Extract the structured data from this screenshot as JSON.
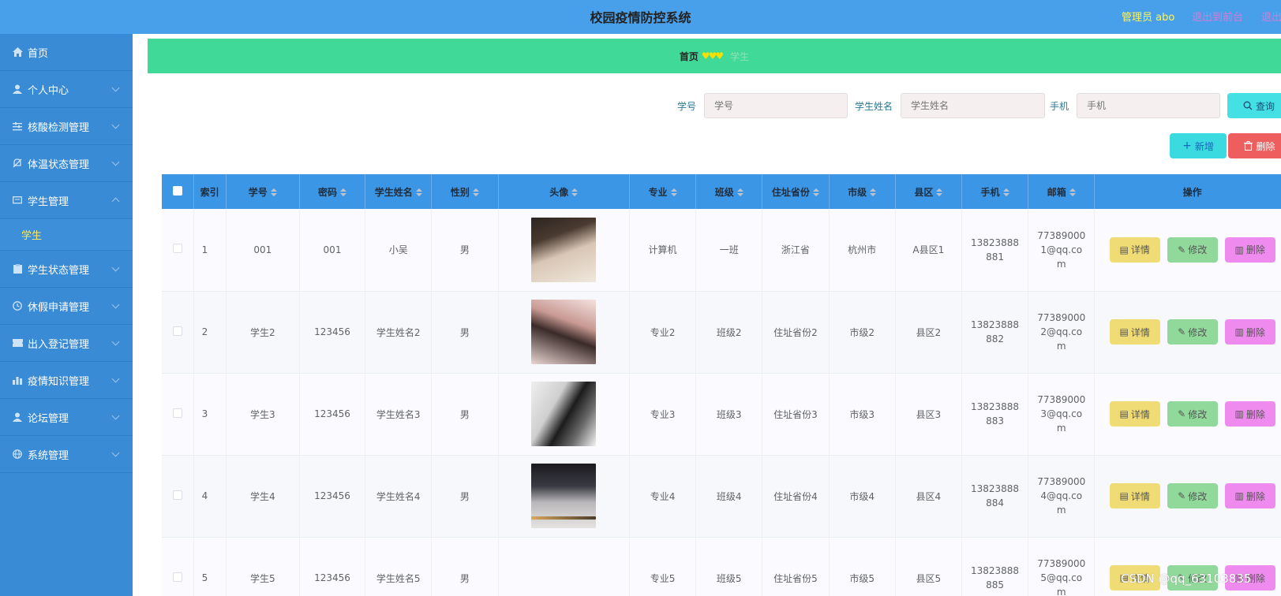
{
  "header": {
    "title": "校园疫情防控系统",
    "admin_label": "管理员 abo",
    "front_link": "退出到前台",
    "logout_link": "退出登录"
  },
  "sidebar": {
    "items": [
      {
        "label": "首页",
        "icon": "home-icon"
      },
      {
        "label": "个人中心",
        "icon": "user-icon"
      },
      {
        "label": "核酸检测管理",
        "icon": "sliders-icon"
      },
      {
        "label": "体温状态管理",
        "icon": "bell-off-icon"
      },
      {
        "label": "学生管理",
        "icon": "message-icon",
        "expanded": true
      },
      {
        "label": "学生状态管理",
        "icon": "clipboard-icon"
      },
      {
        "label": "休假申请管理",
        "icon": "clock-icon"
      },
      {
        "label": "出入登记管理",
        "icon": "ticket-icon"
      },
      {
        "label": "疫情知识管理",
        "icon": "chart-icon"
      },
      {
        "label": "论坛管理",
        "icon": "user-icon"
      },
      {
        "label": "系统管理",
        "icon": "globe-icon"
      }
    ],
    "submenu": {
      "label": "学生"
    }
  },
  "breadcrumb": {
    "home": "首页",
    "hearts": "♥♥♥",
    "current": "学生"
  },
  "search": {
    "student_id_label": "学号",
    "student_id_placeholder": "学号",
    "name_label": "学生姓名",
    "name_placeholder": "学生姓名",
    "phone_label": "手机",
    "phone_placeholder": "手机",
    "query_label": "查询"
  },
  "actions": {
    "add_label": "新增",
    "delete_label": "删除"
  },
  "table": {
    "headers": {
      "index": "索引",
      "student_id": "学号",
      "password": "密码",
      "name": "学生姓名",
      "gender": "性别",
      "avatar": "头像",
      "major": "专业",
      "class": "班级",
      "province": "住址省份",
      "city": "市级",
      "county": "县区",
      "phone": "手机",
      "email": "邮箱",
      "ops": "操作"
    },
    "op_labels": {
      "detail": "详情",
      "edit": "修改",
      "delete": "删除"
    },
    "rows": [
      {
        "index": "1",
        "student_id": "001",
        "password": "001",
        "name": "小吴",
        "gender": "男",
        "major": "计算机",
        "class": "一班",
        "province": "浙江省",
        "city": "杭州市",
        "county": "A县区1",
        "phone": "13823888881",
        "email": "773890001@qq.com"
      },
      {
        "index": "2",
        "student_id": "学生2",
        "password": "123456",
        "name": "学生姓名2",
        "gender": "男",
        "major": "专业2",
        "class": "班级2",
        "province": "住址省份2",
        "city": "市级2",
        "county": "县区2",
        "phone": "13823888882",
        "email": "773890002@qq.com"
      },
      {
        "index": "3",
        "student_id": "学生3",
        "password": "123456",
        "name": "学生姓名3",
        "gender": "男",
        "major": "专业3",
        "class": "班级3",
        "province": "住址省份3",
        "city": "市级3",
        "county": "县区3",
        "phone": "13823888883",
        "email": "773890003@qq.com"
      },
      {
        "index": "4",
        "student_id": "学生4",
        "password": "123456",
        "name": "学生姓名4",
        "gender": "男",
        "major": "专业4",
        "class": "班级4",
        "province": "住址省份4",
        "city": "市级4",
        "county": "县区4",
        "phone": "13823888884",
        "email": "773890004@qq.com"
      },
      {
        "index": "5",
        "student_id": "学生5",
        "password": "123456",
        "name": "学生姓名5",
        "gender": "男",
        "major": "专业5",
        "class": "班级5",
        "province": "住址省份5",
        "city": "市级5",
        "county": "县区5",
        "phone": "13823888885",
        "email": "773890005@qq.com"
      }
    ]
  },
  "watermark": "CSDN @qq_63103835"
}
